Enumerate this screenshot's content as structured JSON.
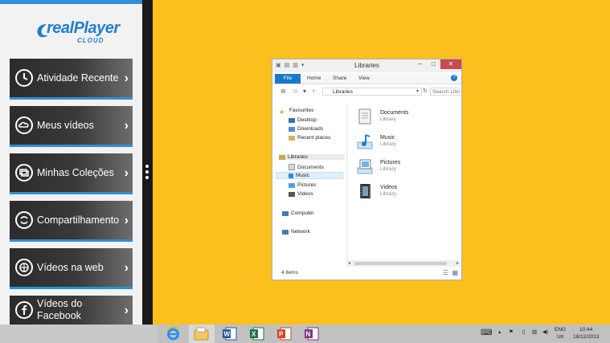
{
  "app": {
    "brand": "realPlayer",
    "brand_sub": "CLOUD"
  },
  "sidebar": {
    "items": [
      {
        "label": "Atividade Recente",
        "icon": "clock-icon"
      },
      {
        "label": "Meus vídeos",
        "icon": "cloud-icon"
      },
      {
        "label": "Minhas Coleções",
        "icon": "collections-icon"
      },
      {
        "label": "Compartilhamento",
        "icon": "share-icon"
      },
      {
        "label": "Vídeos na web",
        "icon": "globe-icon"
      },
      {
        "label": "Vídeos do Facebook",
        "icon": "facebook-icon"
      }
    ],
    "chevron": "›"
  },
  "explorer": {
    "title": "Libraries",
    "ribbon": {
      "file": "File",
      "tabs": [
        "Home",
        "Share",
        "View"
      ],
      "help": "?"
    },
    "address": {
      "path": "Libraries",
      "search_placeholder": "Search Libr"
    },
    "nav": {
      "favourites": "Favourites",
      "favourite_items": [
        "Desktop",
        "Downloads",
        "Recent places"
      ],
      "libraries": "Libraries",
      "library_items": [
        "Documents",
        "Music",
        "Pictures",
        "Videos"
      ],
      "computer": "Computer",
      "network": "Network"
    },
    "libraries": [
      {
        "name": "Documents",
        "type": "Library"
      },
      {
        "name": "Music",
        "type": "Library"
      },
      {
        "name": "Pictures",
        "type": "Library"
      },
      {
        "name": "Videos",
        "type": "Library"
      }
    ],
    "status": "4 items"
  },
  "taskbar": {
    "apps": [
      "internet-explorer-icon",
      "file-explorer-icon",
      "word-icon",
      "excel-icon",
      "powerpoint-icon",
      "onenote-icon"
    ],
    "tray": {
      "lang": "ENG",
      "region": "UK",
      "time": "10:44",
      "date": "18/12/2013"
    }
  },
  "colors": {
    "background": "#fbbf1e",
    "accent": "#2f8fd8",
    "ribbon_file": "#1979ca",
    "close": "#c74b50"
  }
}
